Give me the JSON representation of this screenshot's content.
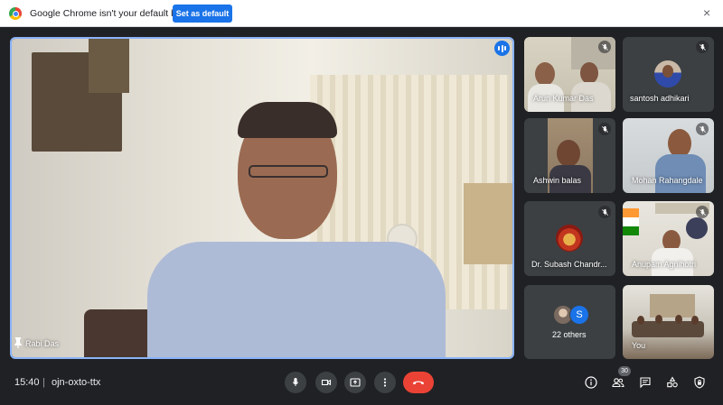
{
  "infobar": {
    "message": "Google Chrome isn't your default browser",
    "set_default_label": "Set as default",
    "close_glyph": "×"
  },
  "main_video": {
    "participant": "Rabi Das",
    "speaking": true
  },
  "participants": [
    {
      "name": "Arun Kumar Das",
      "muted": true
    },
    {
      "name": "santosh adhikari",
      "muted": true
    },
    {
      "name": "Ashwin balas",
      "muted": true
    },
    {
      "name": "Mohan Rahangdale",
      "muted": true
    },
    {
      "name": "Dr. Subash Chandr...",
      "muted": true
    },
    {
      "name": "Anupam Agnihotri",
      "muted": true
    },
    {
      "name": "22 others",
      "avatar_letter": "S"
    },
    {
      "name": "You"
    }
  ],
  "bottombar": {
    "time": "15:40",
    "separator": "|",
    "meeting_code": "ojn-oxto-ttx",
    "people_count": "30"
  },
  "colors": {
    "accent_blue": "#1a73e8",
    "end_call_red": "#ea4335",
    "bar_bg": "#202124",
    "tile_bg": "#3c4043"
  }
}
